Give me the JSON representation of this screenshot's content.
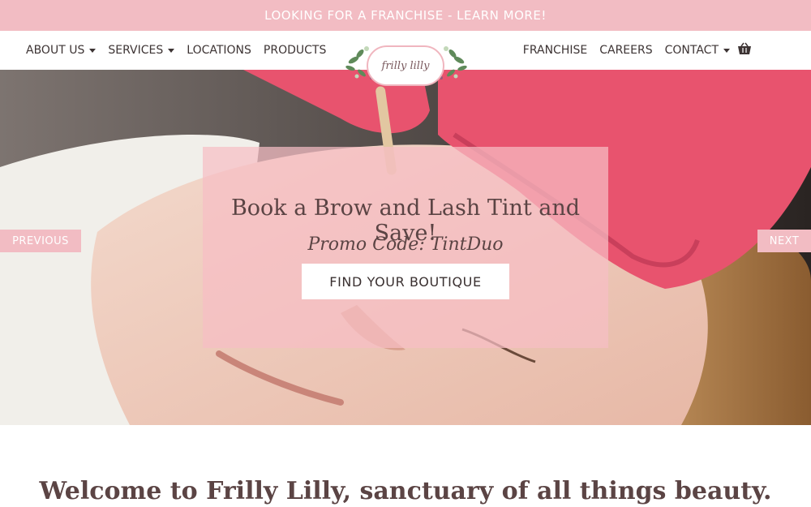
{
  "announcement": {
    "text": "LOOKING FOR A FRANCHISE - LEARN MORE!"
  },
  "nav": {
    "left": [
      {
        "label": "ABOUT US",
        "dropdown": true
      },
      {
        "label": "SERVICES",
        "dropdown": true
      },
      {
        "label": "LOCATIONS",
        "dropdown": false
      },
      {
        "label": "PRODUCTS",
        "dropdown": false
      }
    ],
    "right": [
      {
        "label": "FRANCHISE",
        "dropdown": false
      },
      {
        "label": "CAREERS",
        "dropdown": false
      },
      {
        "label": "CONTACT",
        "dropdown": true
      }
    ],
    "cart_icon": "basket-icon"
  },
  "logo": {
    "text": "frilly lilly"
  },
  "hero": {
    "title": "Book a Brow and Lash Tint and Save!",
    "promo": "Promo Code: TintDuo",
    "cta": "FIND YOUR BOUTIQUE",
    "prev_label": "PREVIOUS",
    "next_label": "NEXT"
  },
  "welcome": {
    "heading": "Welcome to Frilly Lilly, sanctuary of all things beauty."
  },
  "colors": {
    "accent_pink": "#f2bcc3",
    "overlay_pink": "#f6bec5",
    "text_dark": "#5b4444",
    "glove_pink": "#e8536e"
  }
}
